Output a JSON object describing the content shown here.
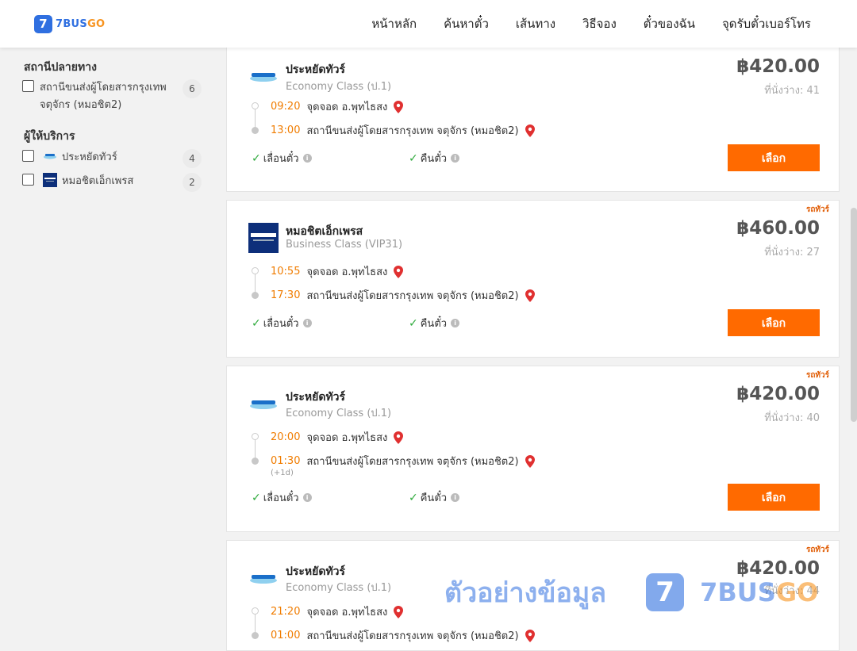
{
  "header": {
    "logo_mark": "7",
    "logo_text_a": "7BUS",
    "logo_text_b": "GO",
    "nav": [
      "หน้าหลัก",
      "ค้นหาตั๋ว",
      "เส้นทาง",
      "วิธีจอง",
      "ตั๋วของฉัน",
      "จุดรับตั๋วเบอร์โทร"
    ]
  },
  "sidebar": {
    "destination_title": "สถานีปลายทาง",
    "destinations": [
      {
        "label_line1": "สถานีขนส่งผู้โดยสารกรุงเทพ",
        "label_line2": "จตุจักร (หมอชิต2)",
        "count": "6"
      }
    ],
    "operator_title": "ผู้ให้บริการ",
    "operators": [
      {
        "label": "ประหยัดทัวร์",
        "count": "4"
      },
      {
        "label": "หมอชิตเอ็กเพรส",
        "count": "2"
      }
    ]
  },
  "policies": {
    "change": "เลื่อนตั๋ว",
    "refund": "คืนตั๋ว",
    "info_glyph": "i",
    "check_glyph": "✓"
  },
  "select_label": "เลือก",
  "tour_tag": "รถทัวร์",
  "trips": [
    {
      "operator": "ประหยัดทัวร์",
      "class": "Economy Class (ป.1)",
      "price": "฿420.00",
      "seats": "ที่นั่งว่าง: 41",
      "dep_time": "09:20",
      "dep_stop": "จุดจอด อ.พุทไธสง",
      "arr_time": "13:00",
      "arr_stop": "สถานีขนส่งผู้โดยสารกรุงเทพ จตุจักร (หมอชิต2)"
    },
    {
      "operator": "หมอชิตเอ็กเพรส",
      "class": "Business Class (VIP31)",
      "price": "฿460.00",
      "seats": "ที่นั่งว่าง: 27",
      "dep_time": "10:55",
      "dep_stop": "จุดจอด อ.พุทไธสง",
      "arr_time": "17:30",
      "arr_stop": "สถานีขนส่งผู้โดยสารกรุงเทพ จตุจักร (หมอชิต2)"
    },
    {
      "operator": "ประหยัดทัวร์",
      "class": "Economy Class (ป.1)",
      "price": "฿420.00",
      "seats": "ที่นั่งว่าง: 40",
      "dep_time": "20:00",
      "dep_stop": "จุดจอด อ.พุทไธสง",
      "arr_time": "01:30",
      "arr_stop": "สถานีขนส่งผู้โดยสารกรุงเทพ จตุจักร (หมอชิต2)",
      "plus_day": "(+1d)"
    },
    {
      "operator": "ประหยัดทัวร์",
      "class": "Economy Class (ป.1)",
      "price": "฿420.00",
      "seats": "ที่นั่งว่าง: 44",
      "dep_time": "21:20",
      "dep_stop": "จุดจอด อ.พุทไธสง",
      "arr_time": "01:00",
      "arr_stop": "สถานีขนส่งผู้โดยสารกรุงเทพ จตุจักร (หมอชิต2)"
    }
  ],
  "watermark": {
    "text": "ตัวอย่างข้อมูล",
    "logo_mark": "7",
    "brand_a": "7BUS",
    "brand_b": "GO"
  },
  "colors": {
    "brand_blue": "#2f6fe0",
    "brand_orange": "#f7931e",
    "button": "#ff6a00",
    "time": "#f07c00",
    "check": "#2eaa3c",
    "pin": "#e03030"
  },
  "icons": {
    "location": "map-pin-icon",
    "info": "info-icon",
    "check": "check-icon"
  }
}
